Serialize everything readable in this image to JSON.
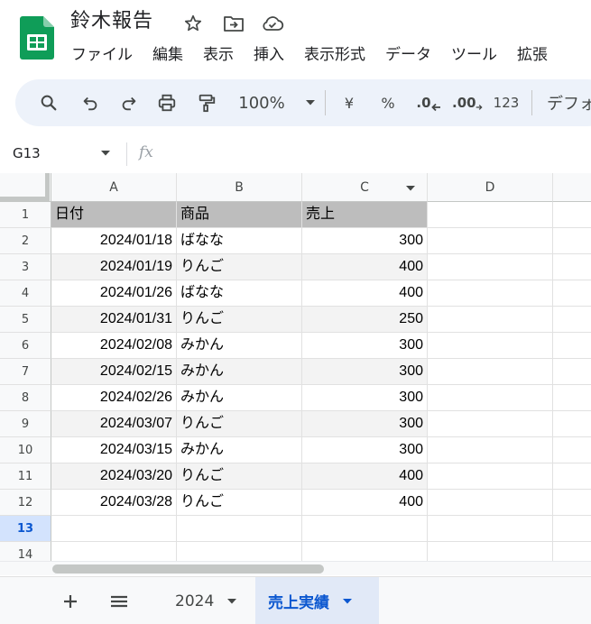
{
  "app": {
    "doc_title": "鈴木報告",
    "icons": {
      "logo": "sheets-logo-icon",
      "star": "star-icon",
      "move": "move-to-folder-icon",
      "cloud": "cloud-saved-icon"
    }
  },
  "menu": [
    "ファイル",
    "編集",
    "表示",
    "挿入",
    "表示形式",
    "データ",
    "ツール",
    "拡張"
  ],
  "toolbar": {
    "zoom": "100%",
    "currency": "¥",
    "percent": "%",
    "decrease_decimal": ".0",
    "increase_decimal": ".00",
    "number_format": "123",
    "font_name": "デフォ"
  },
  "formula_bar": {
    "name_box": "G13",
    "fx": "fx",
    "content": ""
  },
  "grid": {
    "columns": [
      "A",
      "B",
      "C",
      "D"
    ],
    "selected_row": 13,
    "row_numbers": [
      1,
      2,
      3,
      4,
      5,
      6,
      7,
      8,
      9,
      10,
      11,
      12,
      13,
      14
    ],
    "header": [
      "日付",
      "商品",
      "売上"
    ],
    "rows": [
      [
        "2024/01/18",
        "ばなな",
        "300"
      ],
      [
        "2024/01/19",
        "りんご",
        "400"
      ],
      [
        "2024/01/26",
        "ばなな",
        "400"
      ],
      [
        "2024/01/31",
        "りんご",
        "250"
      ],
      [
        "2024/02/08",
        "みかん",
        "300"
      ],
      [
        "2024/02/15",
        "みかん",
        "300"
      ],
      [
        "2024/02/26",
        "みかん",
        "300"
      ],
      [
        "2024/03/07",
        "りんご",
        "300"
      ],
      [
        "2024/03/15",
        "みかん",
        "300"
      ],
      [
        "2024/03/20",
        "りんご",
        "400"
      ],
      [
        "2024/03/28",
        "りんご",
        "400"
      ]
    ]
  },
  "sheets": {
    "tabs": [
      {
        "label": "2024",
        "active": false
      },
      {
        "label": "売上実績",
        "active": true
      }
    ]
  },
  "colors": {
    "accent": "#0b57d0",
    "sheets_green": "#0f9d58",
    "toolbar_bg": "#edf2fa",
    "header_fill": "#bdbdbd",
    "band_fill": "#f3f3f3",
    "active_tab_bg": "#e1e9f7"
  }
}
